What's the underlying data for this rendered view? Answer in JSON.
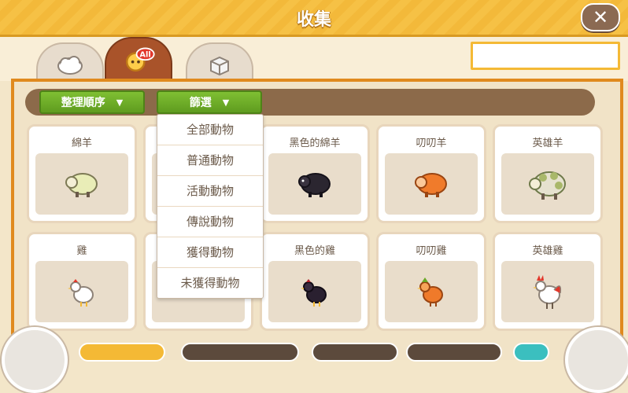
{
  "header": {
    "title": "收集",
    "close_icon": "close-icon"
  },
  "tabs": [
    {
      "icon": "cloud-icon",
      "active": false
    },
    {
      "icon": "all-animals-icon",
      "badge": "All",
      "active": true
    },
    {
      "icon": "box-icon",
      "active": false
    }
  ],
  "search": {
    "value": ""
  },
  "toolbar": {
    "sort_label": "整理順序",
    "filter_label": "篩選"
  },
  "filter_menu": [
    "全部動物",
    "普通動物",
    "活動動物",
    "傳說動物",
    "獲得動物",
    "未獲得動物"
  ],
  "cards": [
    {
      "name": "綿羊",
      "color": "#e9edb7"
    },
    {
      "name": "",
      "color": "#f2f2f2"
    },
    {
      "name": "黑色的綿羊",
      "color": "#2b2630"
    },
    {
      "name": "叨叨羊",
      "color": "#f07b2b"
    },
    {
      "name": "英雄羊",
      "color": "#e6e2cf"
    },
    {
      "name": "雞",
      "color": "#ffffff"
    },
    {
      "name": "",
      "color": "#f2f2f2"
    },
    {
      "name": "黑色的雞",
      "color": "#2a2030"
    },
    {
      "name": "叨叨雞",
      "color": "#ef7a2a"
    },
    {
      "name": "英雄雞",
      "color": "#ffffff"
    }
  ],
  "colors": {
    "accent": "#f4b935",
    "panel_border": "#e08a1e",
    "button_green": "#6aa826",
    "tab_active": "#a9532a"
  }
}
